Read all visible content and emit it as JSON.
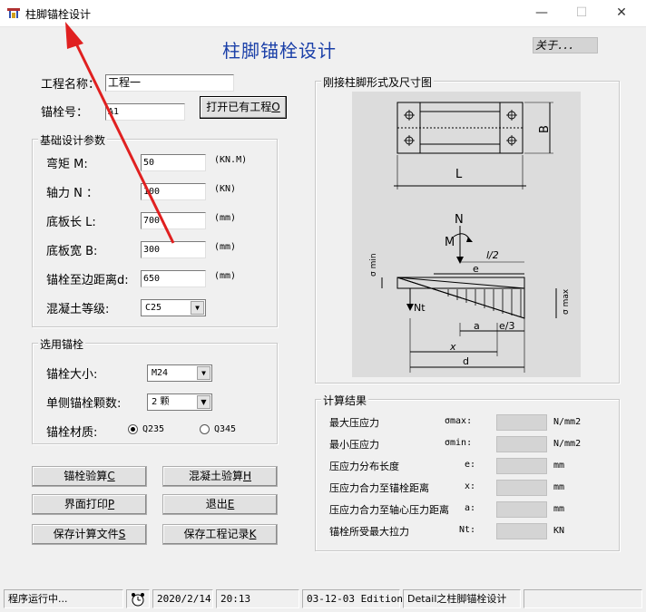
{
  "window": {
    "title": "柱脚锚栓设计",
    "min_glyph": "—",
    "max_glyph": "☐",
    "close_glyph": "✕"
  },
  "header": {
    "title": "柱脚锚栓设计",
    "about_label": "关于．．．"
  },
  "project": {
    "name_label": "工程名称：",
    "name_value": "工程一",
    "bolt_no_label": "锚栓号：",
    "bolt_no_value": "A1",
    "open_button": "打开已有工程",
    "open_button_key": "O"
  },
  "foundation": {
    "legend": "基础设计参数",
    "moment_label": "弯矩 M:",
    "moment_value": "50",
    "moment_unit": "(KN.M)",
    "axial_label": "轴力 N ：",
    "axial_value": "100",
    "axial_unit": "(KN)",
    "length_label": "底板长 L:",
    "length_value": "700",
    "length_unit": "(mm)",
    "width_label": "底板宽 B:",
    "width_value": "300",
    "width_unit": "(mm)",
    "edge_label": "锚栓至边距离d:",
    "edge_value": "650",
    "edge_unit": "(mm)",
    "concrete_label": "混凝土等级:",
    "concrete_value": "C25"
  },
  "bolt_select": {
    "legend": "选用锚栓",
    "size_label": "锚栓大小:",
    "size_value": "M24",
    "count_label": "单侧锚栓颗数:",
    "count_value": "2 颗",
    "material_label": "锚栓材质:",
    "material_options": [
      "Q235",
      "Q345"
    ],
    "material_selected": "Q235"
  },
  "buttons": {
    "check_bolt": "锚栓验算",
    "check_bolt_key": "C",
    "check_concrete": "混凝土验算",
    "check_concrete_key": "H",
    "print": "界面打印",
    "print_key": "P",
    "exit": "退出",
    "exit_key": "E",
    "save_calc": "保存计算文件",
    "save_calc_key": "S",
    "save_record": "保存工程记录",
    "save_record_key": "K"
  },
  "diagram": {
    "legend": "刚接柱脚形式及尺寸图",
    "labels": {
      "B": "B",
      "L": "L",
      "N": "N",
      "M": "M",
      "l2": "l/2",
      "e": "e",
      "sigma_min": "σ min",
      "sigma_max": "σ max",
      "Nt": "Nt",
      "a": "a",
      "e3": "e/3",
      "x": "x",
      "d": "d"
    }
  },
  "results": {
    "legend": "计算结果",
    "rows": [
      {
        "label": "最大压应力",
        "symbol": "σmax:",
        "value": "",
        "unit": "N/mm2"
      },
      {
        "label": "最小压应力",
        "symbol": "σmin:",
        "value": "",
        "unit": "N/mm2"
      },
      {
        "label": "压应力分布长度",
        "symbol": "e:",
        "value": "",
        "unit": "mm"
      },
      {
        "label": "压应力合力至锚栓距离",
        "symbol": "x:",
        "value": "",
        "unit": "mm"
      },
      {
        "label": "压应力合力至轴心压力距离",
        "symbol": "a:",
        "value": "",
        "unit": "mm"
      },
      {
        "label": "锚栓所受最大拉力",
        "symbol": "Nt:",
        "value": "",
        "unit": "KN"
      }
    ]
  },
  "status": {
    "message": "程序运行中...",
    "date": "2020/2/14",
    "time": "20:13",
    "edition": "03-12-03 Edition",
    "module": "Detail之柱脚锚栓设计"
  },
  "colors": {
    "accent_title": "#1a3fa8",
    "arrow": "#e02020",
    "panel": "#dcdcdc"
  }
}
